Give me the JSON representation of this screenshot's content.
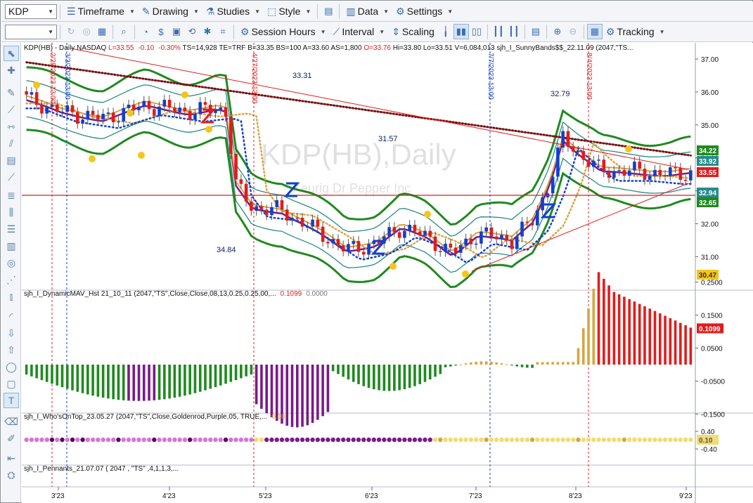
{
  "toolbar_top": {
    "symbol": "KDP",
    "items": [
      {
        "label": "Timeframe",
        "icon": "timeframe-icon"
      },
      {
        "label": "Drawing",
        "icon": "drawing-icon"
      },
      {
        "label": "Studies",
        "icon": "studies-icon"
      },
      {
        "label": "Style",
        "icon": "style-icon"
      },
      {
        "label": "Data",
        "icon": "data-icon"
      },
      {
        "label": "Settings",
        "icon": "gear-icon"
      }
    ]
  },
  "toolbar_second": {
    "items": [
      {
        "label": "Session Hours",
        "icon": "session-hours-icon"
      },
      {
        "label": "Interval",
        "icon": "interval-icon"
      },
      {
        "label": "Scaling",
        "icon": "scaling-icon"
      },
      {
        "label": "Tracking",
        "icon": "tracking-icon"
      }
    ]
  },
  "main_panel": {
    "header_prefix": "KDP(HB) - Daily  NASDAQ  ",
    "last": "L=33.55",
    "chg": "-0.10",
    "pct": "-0.30%",
    "header_mid": "  TS=14,928  TE=TRF  B=33.35  BS=100  A=33.60  AS=1,800  ",
    "open": "O=33.76",
    "header_rest": "  Hi=33.80  Lo=33.51  V=6,084,013  sjh_I_SunnyBands$$_22.11.09 (2047,\"TS...",
    "watermark_symbol": "KDP(HB),Daily",
    "watermark_name": "Keurig Dr Pepper Inc",
    "price_ticks": [
      "37.00",
      "36.00",
      "35.00",
      "34.00",
      "33.00",
      "32.00",
      "31.00"
    ],
    "price_tags": [
      {
        "text": "34.22",
        "color": "#1f8a1f"
      },
      {
        "text": "33.92",
        "color": "#2a8a8a"
      },
      {
        "text": "33.55",
        "color": "#e21c1c"
      },
      {
        "text": "32.94",
        "color": "#2a8a8a"
      },
      {
        "text": "32.65",
        "color": "#1f8a1f"
      },
      {
        "text": "30.47",
        "color": "#f5c518"
      }
    ],
    "hline_label": "32.84",
    "annotations": [
      "33.31",
      "32.79",
      "31.57",
      "34.84"
    ],
    "date_markers": [
      "2/28/2023 13:00",
      "3/3/2023 13:00",
      "4/27/2023 13:00",
      "7/7/2023 13:00",
      "8/4/2023 13:00"
    ]
  },
  "panel2": {
    "title": "sjh_I_DynamicMAV_Hst 21_10_11 (2047,\"TS\",Close,Close,08,13,0.25,0.25,00,...",
    "v1": "0.1099",
    "v2": "0.0000",
    "ticks": [
      "0.2500",
      "0.1500",
      "0.0500",
      "-0.0500",
      "-0.1500"
    ],
    "tag": "0.1099"
  },
  "panel3": {
    "title": "sjh_I_Who'sOnTop_23.05.27 (2047,\"TS\",Close,Goldenrod,Purple,05,  TRUE,...",
    "v1": "0.10",
    "ticks": [
      "0.40",
      "-0.40"
    ],
    "tag": "0.10"
  },
  "panel4": {
    "title": "sjh_I_Pennants_21.07.07 ( 2047 , \"TS\" ,4,1,1,3,..."
  },
  "x_axis": [
    "3'23",
    "4'23",
    "5'23",
    "6'23",
    "7'23",
    "8'23",
    "9'23"
  ],
  "colors": {
    "up": "#1040d0",
    "down": "#e21c1c",
    "green_band": "#1f8a1f",
    "teal_band": "#2a8a8a",
    "purple": "#7a1a8a",
    "gold": "#d9a441",
    "maroon": "#7a1010",
    "yellow": "#f5c518"
  }
}
